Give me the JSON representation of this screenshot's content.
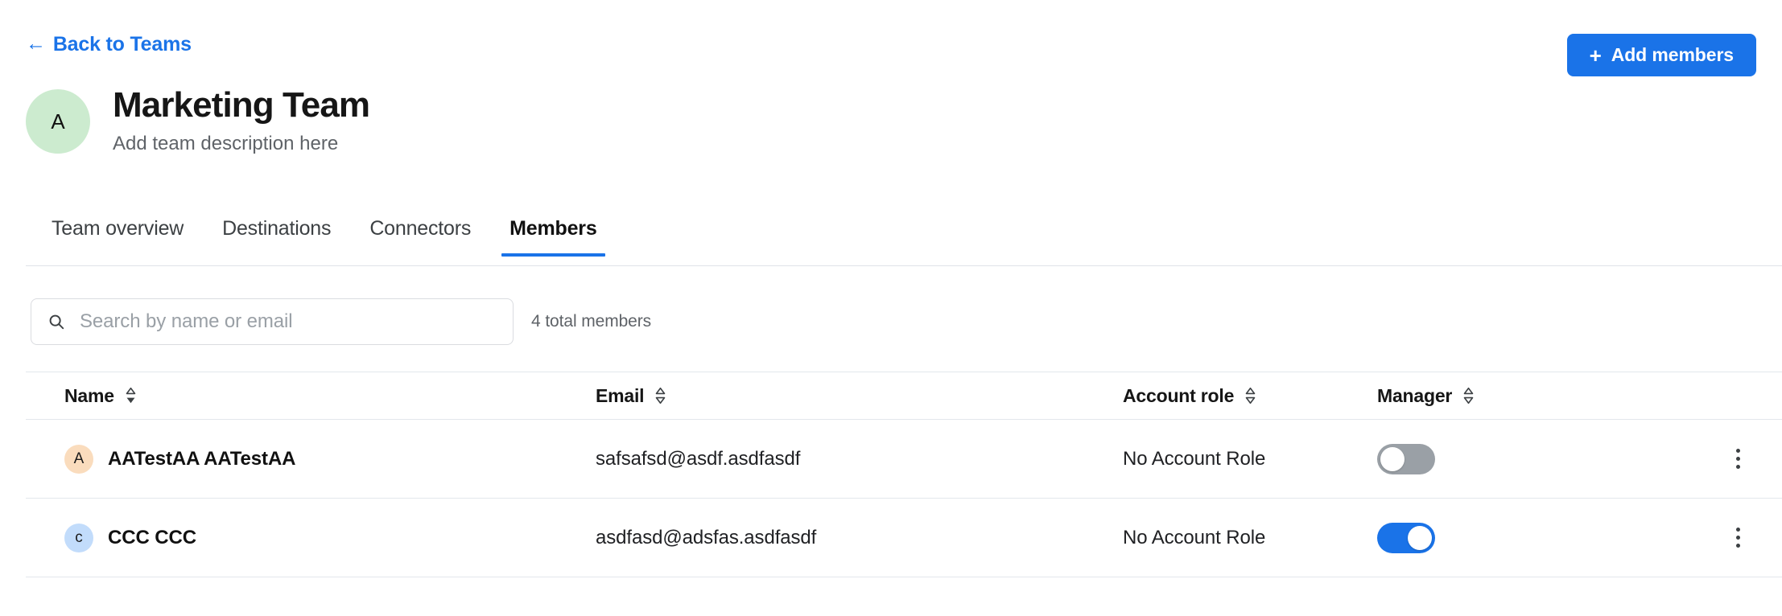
{
  "header": {
    "back_link": "Back to Teams",
    "back_icon": "arrow-left-icon",
    "add_members_label": "Add members",
    "add_members_icon": "plus-icon"
  },
  "team": {
    "avatar_letter": "A",
    "avatar_color": "#ccebcf",
    "name": "Marketing Team",
    "description": "Add team description here"
  },
  "tabs": [
    {
      "label": "Team overview",
      "active": false
    },
    {
      "label": "Destinations",
      "active": false
    },
    {
      "label": "Connectors",
      "active": false
    },
    {
      "label": "Members",
      "active": true
    }
  ],
  "toolbar": {
    "search_placeholder": "Search by name or email",
    "search_value": "",
    "search_icon": "search-icon",
    "total_members": "4 total members"
  },
  "table": {
    "columns": [
      {
        "label": "Name",
        "sort_icon": "sort-descending-icon",
        "sorted": true
      },
      {
        "label": "Email",
        "sort_icon": "sort-none-icon",
        "sorted": false
      },
      {
        "label": "Account role",
        "sort_icon": "sort-none-icon",
        "sorted": false
      },
      {
        "label": "Manager",
        "sort_icon": "sort-none-icon",
        "sorted": false
      }
    ],
    "rows": [
      {
        "avatar_letter": "A",
        "avatar_color": "#fadcbd",
        "name": "AATestAA AATestAA",
        "email": "safsafsd@asdf.asdfasdf",
        "account_role": "No Account Role",
        "manager": false,
        "menu_icon": "kebab-menu-icon"
      },
      {
        "avatar_letter": "c",
        "avatar_color": "#c2dcfb",
        "name": "CCC CCC",
        "email": "asdfasd@adsfas.asdfasdf",
        "account_role": "No Account Role",
        "manager": true,
        "menu_icon": "kebab-menu-icon"
      }
    ]
  },
  "colors": {
    "accent": "#1a73e8",
    "toggle_off": "#9aa0a6",
    "text_primary": "#202124",
    "text_muted": "#5f6368",
    "border": "#e3e7ec"
  }
}
